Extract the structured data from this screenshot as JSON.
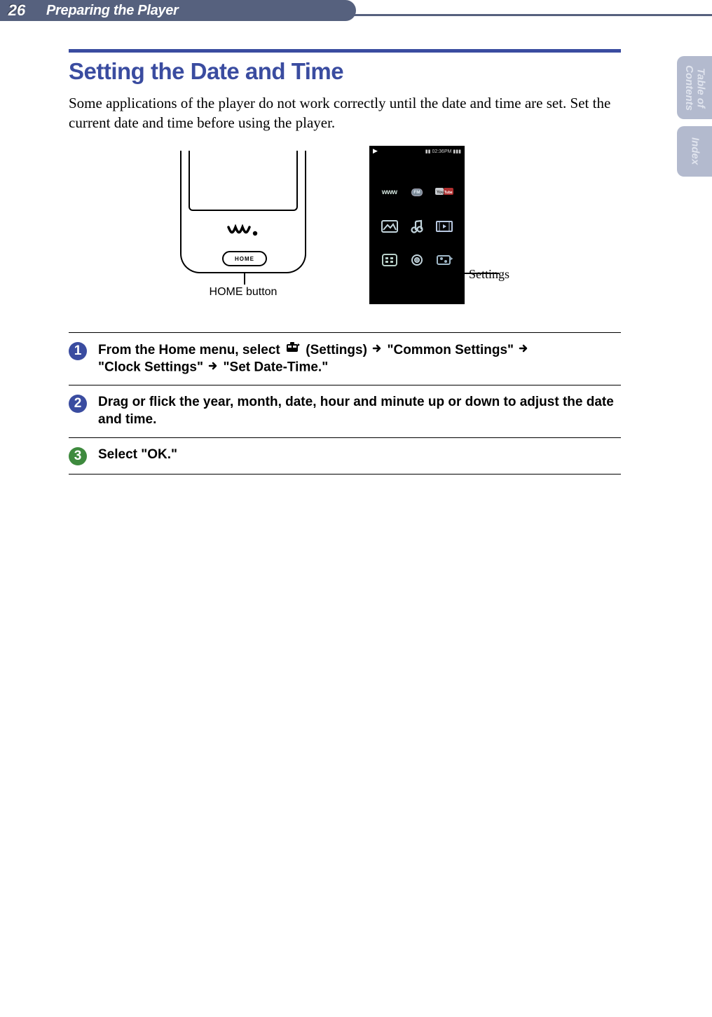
{
  "header": {
    "page_number": "26",
    "chapter": "Preparing the Player"
  },
  "side_tabs": {
    "toc": "Table of\nContents",
    "index": "Index"
  },
  "title": "Setting the Date and Time",
  "intro": "Some applications of the player do not work correctly until the date and time are set. Set the current date and time before using the player.",
  "device": {
    "home_button": "HOME",
    "home_caption": "HOME button"
  },
  "screen": {
    "status_time": "02:36PM",
    "icons": {
      "browser": "www",
      "fm": "FM",
      "youtube": "YouTube",
      "photo": "photo-icon",
      "music": "music-icon",
      "video": "video-icon",
      "apps": "apps-icon",
      "podcast": "podcast-icon",
      "settings": "settings-icon"
    },
    "caption": "Settings"
  },
  "steps": [
    {
      "num": "1",
      "parts": {
        "a": "From the Home menu, select ",
        "b": " (Settings) ",
        "c": " \"Common Settings\" ",
        "d": " \"Clock Settings\" ",
        "e": " \"Set Date-Time.\""
      }
    },
    {
      "num": "2",
      "text": "Drag or flick the year, month, date, hour and minute up or down to adjust the date and time."
    },
    {
      "num": "3",
      "text": "Select \"OK.\""
    }
  ]
}
